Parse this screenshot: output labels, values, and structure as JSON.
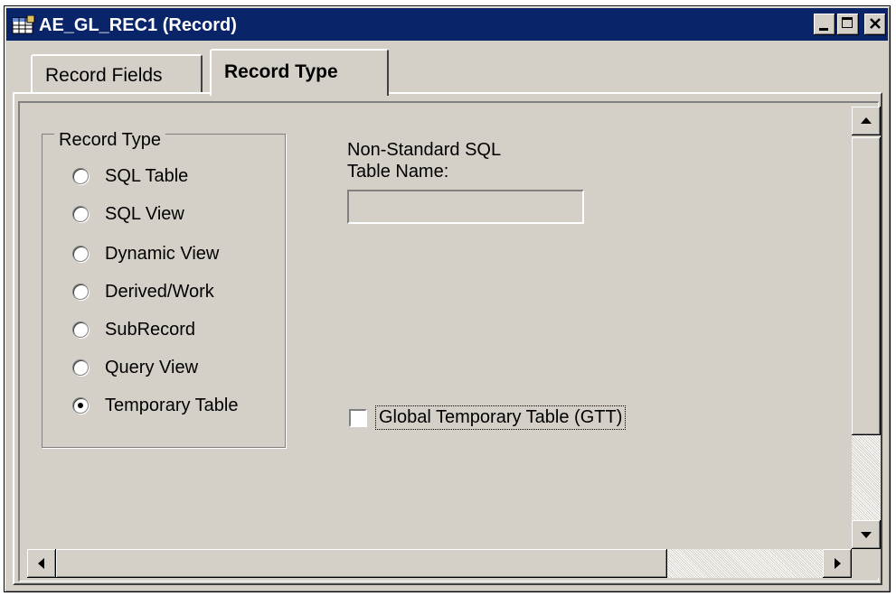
{
  "window": {
    "title": "AE_GL_REC1 (Record)"
  },
  "tabs": [
    {
      "label": "Record Fields",
      "active": false
    },
    {
      "label": "Record Type",
      "active": true
    }
  ],
  "record_type_group": {
    "label": "Record Type",
    "options": [
      {
        "label": "SQL Table",
        "selected": false
      },
      {
        "label": "SQL View",
        "selected": false
      },
      {
        "label": "Dynamic View",
        "selected": false
      },
      {
        "label": "Derived/Work",
        "selected": false
      },
      {
        "label": "SubRecord",
        "selected": false
      },
      {
        "label": "Query View",
        "selected": false
      },
      {
        "label": "Temporary Table",
        "selected": true
      }
    ]
  },
  "non_standard_sql": {
    "label_line1": "Non-Standard SQL",
    "label_line2": "Table Name:",
    "value": ""
  },
  "gtt": {
    "label": "Global Temporary Table (GTT)",
    "checked": false
  },
  "colors": {
    "titlebar": "#0a246a",
    "face": "#d4d0c8"
  }
}
